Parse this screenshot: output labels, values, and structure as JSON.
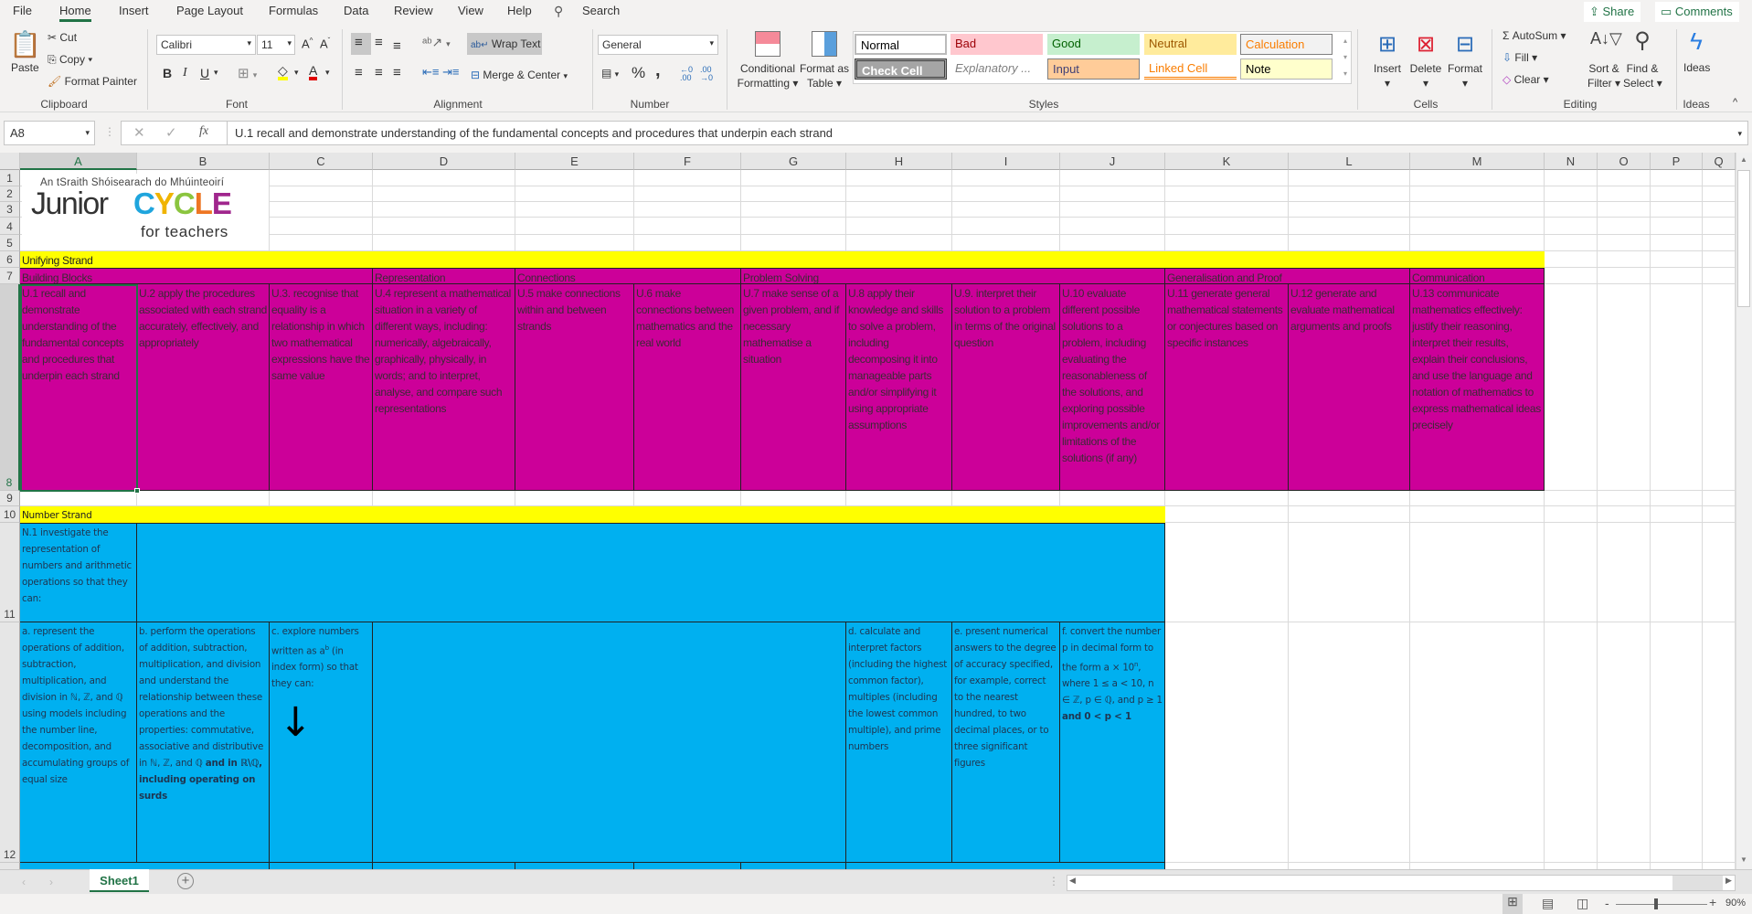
{
  "ribbon": {
    "tabs": [
      "File",
      "Home",
      "Insert",
      "Page Layout",
      "Formulas",
      "Data",
      "Review",
      "View",
      "Help"
    ],
    "active_tab": "Home",
    "search": "Search",
    "share": "Share",
    "comments": "Comments",
    "clipboard": {
      "paste": "Paste",
      "cut": "Cut",
      "copy": "Copy",
      "format_painter": "Format Painter",
      "label": "Clipboard"
    },
    "font": {
      "name": "Calibri",
      "size": "11",
      "bold": "B",
      "italic": "I",
      "underline": "U",
      "label": "Font",
      "fill_color": "#ffff00",
      "font_color": "#e00000"
    },
    "alignment": {
      "wrap_text": "Wrap Text",
      "merge_center": "Merge & Center",
      "label": "Alignment"
    },
    "number": {
      "format": "General",
      "percent": "%",
      "comma": ",",
      "label": "Number"
    },
    "styles": {
      "conditional": "Conditional",
      "formatting": "Formatting",
      "format_as": "Format as",
      "table": "Table",
      "items": [
        {
          "label": "Normal",
          "bg": "#ffffff",
          "fg": "#000000"
        },
        {
          "label": "Bad",
          "bg": "#ffc7ce",
          "fg": "#9c0006"
        },
        {
          "label": "Good",
          "bg": "#c6efce",
          "fg": "#006100"
        },
        {
          "label": "Neutral",
          "bg": "#ffeb9c",
          "fg": "#9c5700"
        },
        {
          "label": "Calculation",
          "bg": "#f2f2f2",
          "fg": "#fa7d00"
        },
        {
          "label": "Check Cell",
          "bg": "#a5a5a5",
          "fg": "#ffffff"
        },
        {
          "label": "Explanatory ...",
          "bg": "#ffffff",
          "fg": "#7f7f7f"
        },
        {
          "label": "Input",
          "bg": "#ffcc99",
          "fg": "#3f3f76"
        },
        {
          "label": "Linked Cell",
          "bg": "#ffffff",
          "fg": "#fa7d00"
        },
        {
          "label": "Note",
          "bg": "#ffffcc",
          "fg": "#000000"
        }
      ],
      "label": "Styles"
    },
    "cells": {
      "insert": "Insert",
      "delete": "Delete",
      "format": "Format",
      "label": "Cells"
    },
    "editing": {
      "autosum": "AutoSum",
      "fill": "Fill",
      "clear": "Clear",
      "sort1": "Sort &",
      "sort2": "Filter",
      "find1": "Find &",
      "find2": "Select",
      "label": "Editing"
    },
    "ideas": {
      "button": "Ideas",
      "label": "Ideas"
    }
  },
  "formula_bar": {
    "name_box": "A8",
    "fx": "fx",
    "content": "U.1 recall and demonstrate understanding of the fundamental concepts and procedures that underpin each strand"
  },
  "columns": [
    "A",
    "B",
    "C",
    "D",
    "E",
    "F",
    "G",
    "H",
    "I",
    "J",
    "K",
    "L",
    "M",
    "N",
    "O",
    "P",
    "Q"
  ],
  "rows": [
    "1",
    "2",
    "3",
    "4",
    "5",
    "6",
    "7",
    "8",
    "9",
    "10",
    "11",
    "12",
    ""
  ],
  "logo": {
    "tagline": "An tSraith Shóisearach do Mhúinteoirí",
    "junior": "Junior",
    "cycle": "CYCLE",
    "for": "for teachers"
  },
  "colors": {
    "unifying": "#cc0099",
    "number": "#00b0f0",
    "heading": "#ffff00"
  },
  "sheet": {
    "unifying_title": "Unifying Strand",
    "unifying_headers": [
      "Building Blocks",
      "Representation",
      "Connections",
      "Problem Solving",
      "Generalisation and Proof",
      "Communication"
    ],
    "unifying_items": [
      "U.1 recall and demonstrate understanding of the fundamental concepts and procedures that underpin each strand",
      "U.2 apply the procedures associated with each strand accurately, effectively, and appropriately",
      "U.3. recognise that equality is a relationship in which two mathematical expressions have the same value",
      "U.4 represent a mathematical situation in a variety of different ways, including: numerically, algebraically, graphically, physically, in words; and to interpret, analyse, and compare such representations",
      "U.5 make connections within and between strands",
      "U.6 make connections between mathematics  and the real world",
      " U.7 make sense of a given problem, and if necessary mathematise a situation",
      " U.8 apply their knowledge and skills to solve a problem, including decomposing it into manageable parts and/or simplifying it using appropriate assumptions",
      " U.9. interpret their solution to a problem in terms of the original question",
      "U.10 evaluate different possible solutions to a problem, including evaluating the reasonableness of the solutions, and exploring possible improvements and/or limitations of the solutions (if any)",
      "U.11  generate general mathematical statements or conjectures based on specific instances",
      "U.12 generate and evaluate mathematical arguments and proofs",
      "U.13 communicate mathematics effectively: justify their reasoning, interpret their results, explain their conclusions, and use the language and notation of mathematics to express mathematical ideas precisely"
    ],
    "number_title": "Number Strand",
    "n1": "N.1 investigate the representation of numbers and arithmetic operations so that they can:",
    "n_items": {
      "a": "a. represent the operations of addition, subtraction, multiplication, and division in ℕ, ℤ, and ℚ using models including the number line, decomposition, and accumulating groups of equal size",
      "b_plain": "b. perform the operations of addition, subtraction, multiplication, and division and understand the relationship between these operations and the properties: commutative, associative and distributive in ℕ, ℤ, and ℚ ",
      "b_bold": "and in ℝ\\ℚ, including operating on surds",
      "c_pre": "c. explore numbers written as a",
      "c_sup": "b",
      "c_post": " (in index form) so that they can:",
      "c_arrow": "↓",
      "d": "d. calculate and interpret factors (including the highest common factor), multiples (including the lowest common multiple), and prime numbers",
      "e": "e. present numerical answers to the degree of accuracy specified, for example, correct to the nearest hundred, to two decimal places, or to three significant figures",
      "f_pre": "f. convert the number p in decimal form to the form a × 10",
      "f_sup": "n",
      "f_mid": ", where 1 ≤ a < 10, n ∈ ℤ, p ∈ ℚ, and p ≥ 1 ",
      "f_bold": "and 0 < p < 1"
    }
  },
  "sheet_tabs": {
    "active": "Sheet1",
    "add": "+"
  },
  "status": {
    "zoom": "90%",
    "zoom_level_percent": 90
  }
}
